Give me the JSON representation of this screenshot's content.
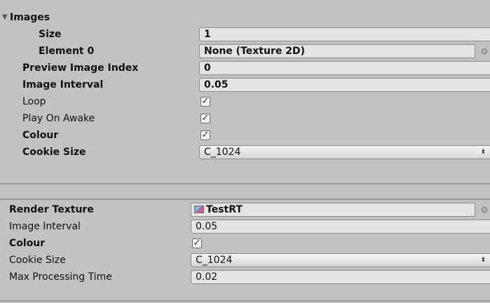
{
  "section1": {
    "images_header": "Images",
    "size_label": "Size",
    "size_value": "1",
    "element0_label": "Element 0",
    "element0_value": "None (Texture 2D)",
    "preview_label": "Preview Image Index",
    "preview_value": "0",
    "interval_label": "Image Interval",
    "interval_value": "0.05",
    "loop_label": "Loop",
    "loop_checked": true,
    "playonawake_label": "Play On Awake",
    "playonawake_checked": true,
    "colour_label": "Colour",
    "colour_checked": true,
    "cookie_label": "Cookie Size",
    "cookie_value": "C_1024"
  },
  "section2": {
    "render_label": "Render Texture",
    "render_value": "TestRT",
    "interval_label": "Image Interval",
    "interval_value": "0.05",
    "colour_label": "Colour",
    "colour_checked": true,
    "cookie_label": "Cookie Size",
    "cookie_value": "C_1024",
    "maxproc_label": "Max Processing Time",
    "maxproc_value": "0.02"
  },
  "icons": {
    "foldout": "triangle-down-icon",
    "check": "checkmark-icon",
    "picker": "object-picker-icon",
    "dropdown": "up-down-arrows-icon",
    "texture": "render-texture-icon"
  },
  "colors": {
    "background": "#c2c2c2",
    "field": "#e4e4e4",
    "check": "#1a3550"
  }
}
